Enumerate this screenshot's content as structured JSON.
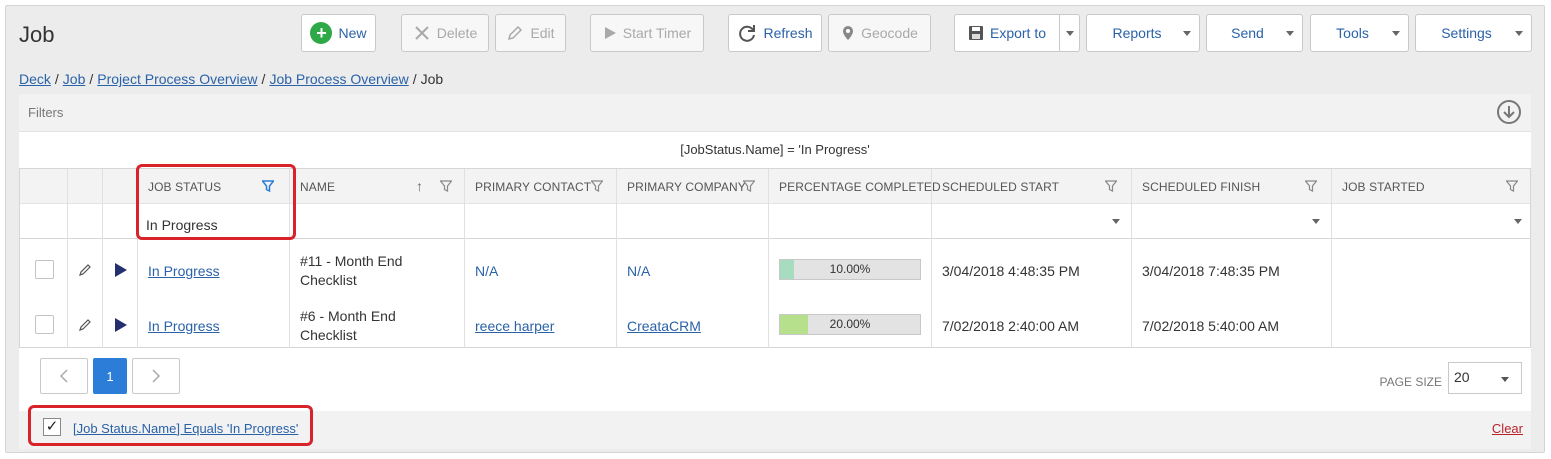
{
  "page": {
    "title": "Job"
  },
  "toolbar": {
    "new_label": "New",
    "delete_label": "Delete",
    "edit_label": "Edit",
    "start_timer_label": "Start Timer",
    "refresh_label": "Refresh",
    "geocode_label": "Geocode",
    "export_label": "Export to",
    "reports_label": "Reports",
    "send_label": "Send",
    "tools_label": "Tools",
    "settings_label": "Settings"
  },
  "breadcrumb": {
    "items": [
      "Deck",
      "Job",
      "Project Process Overview",
      "Job Process Overview"
    ],
    "current": "Job",
    "separator": "/"
  },
  "filters": {
    "label": "Filters",
    "expression": "[JobStatus.Name] = 'In Progress'"
  },
  "grid": {
    "headers": {
      "job_status": "JOB STATUS",
      "name": "NAME",
      "primary_contact": "PRIMARY CONTACT",
      "primary_company": "PRIMARY COMPANY",
      "percentage_completed": "PERCENTAGE COMPLETED",
      "scheduled_start": "SCHEDULED START",
      "scheduled_finish": "SCHEDULED FINISH",
      "job_started": "JOB STARTED"
    },
    "filter_values": {
      "job_status": "In Progress"
    },
    "rows": [
      {
        "job_status": "In Progress",
        "name_line1": "#11 - Month End",
        "name_line2": "Checklist",
        "primary_contact": "N/A",
        "primary_company": "N/A",
        "percentage_completed": "10.00%",
        "percentage_value": 0.1,
        "scheduled_start": "3/04/2018 4:48:35 PM",
        "scheduled_finish": "3/04/2018 7:48:35 PM",
        "job_started": ""
      },
      {
        "job_status": "In Progress",
        "name_line1": "#6 - Month End",
        "name_line2": "Checklist",
        "primary_contact": "reece harper",
        "primary_company": "CreataCRM",
        "percentage_completed": "20.00%",
        "percentage_value": 0.2,
        "scheduled_start": "7/02/2018 2:40:00 AM",
        "scheduled_finish": "7/02/2018 5:40:00 AM",
        "job_started": ""
      }
    ]
  },
  "pager": {
    "current_page": "1",
    "page_size_label": "PAGE SIZE",
    "page_size_value": "20"
  },
  "filter_footer": {
    "checked_glyph": "✓",
    "expression_text": "[Job Status.Name] Equals 'In Progress'",
    "clear_label": "Clear"
  },
  "colors": {
    "accent": "#2a62a8",
    "active_page": "#2b7dd7",
    "progress_fill_row1": "#a8dcc0",
    "progress_fill_row2": "#b7e08d",
    "highlight": "#d9232a",
    "funnel_active": "#2b7dd7"
  }
}
